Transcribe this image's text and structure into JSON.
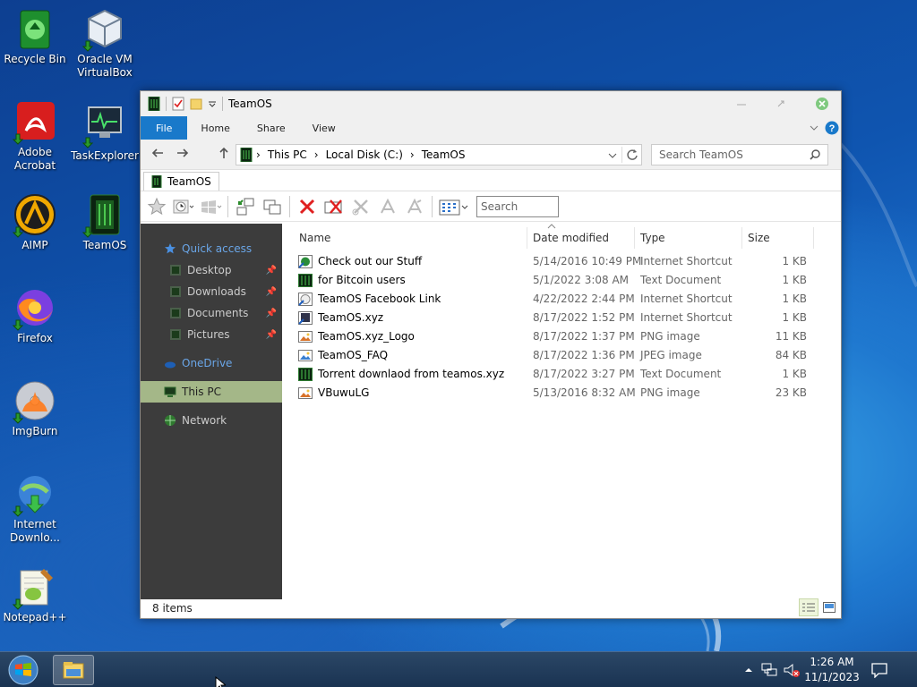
{
  "desktop": {
    "icons": [
      {
        "label": "Recycle Bin",
        "icon": "recycle-bin-icon"
      },
      {
        "label": "Oracle VM VirtualBox",
        "icon": "virtualbox-icon"
      },
      {
        "label": "Adobe Acrobat",
        "icon": "acrobat-icon"
      },
      {
        "label": "TaskExplorer",
        "icon": "task-explorer-icon"
      },
      {
        "label": "AIMP",
        "icon": "aimp-icon"
      },
      {
        "label": "TeamOS",
        "icon": "teamos-icon"
      },
      {
        "label": "Firefox",
        "icon": "firefox-icon"
      },
      {
        "label": "ImgBurn",
        "icon": "imgburn-icon"
      },
      {
        "label": "Internet Downlo...",
        "icon": "internet-download-manager-icon"
      },
      {
        "label": "Notepad++",
        "icon": "notepad-plus-plus-icon"
      }
    ]
  },
  "window": {
    "title": "TeamOS",
    "ribbon_tabs": [
      "File",
      "Home",
      "Share",
      "View"
    ],
    "address": {
      "crumbs": [
        "This PC",
        "Local Disk (C:)",
        "TeamOS"
      ]
    },
    "search_placeholder": "Search TeamOS",
    "folder_tab": "TeamOS",
    "toolbar_search_placeholder": "Search",
    "nav": {
      "quick_access": "Quick access",
      "items": [
        "Desktop",
        "Downloads",
        "Documents",
        "Pictures"
      ],
      "onedrive": "OneDrive",
      "this_pc": "This PC",
      "network": "Network"
    },
    "columns": [
      "Name",
      "Date modified",
      "Type",
      "Size"
    ],
    "files": [
      {
        "name": "Check out our Stuff",
        "date": "5/14/2016 10:49 PM",
        "type": "Internet Shortcut",
        "size": "1 KB",
        "icon": "internet-shortcut-icon"
      },
      {
        "name": "for Bitcoin users",
        "date": "5/1/2022 3:08 AM",
        "type": "Text Document",
        "size": "1 KB",
        "icon": "text-document-icon"
      },
      {
        "name": "TeamOS Facebook Link",
        "date": "4/22/2022 2:44 PM",
        "type": "Internet Shortcut",
        "size": "1 KB",
        "icon": "internet-shortcut-icon"
      },
      {
        "name": "TeamOS.xyz",
        "date": "8/17/2022 1:52 PM",
        "type": "Internet Shortcut",
        "size": "1 KB",
        "icon": "internet-shortcut-icon"
      },
      {
        "name": "TeamOS.xyz_Logo",
        "date": "8/17/2022 1:37 PM",
        "type": "PNG image",
        "size": "11 KB",
        "icon": "png-image-icon"
      },
      {
        "name": "TeamOS_FAQ",
        "date": "8/17/2022 1:36 PM",
        "type": "JPEG image",
        "size": "84 KB",
        "icon": "jpeg-image-icon"
      },
      {
        "name": "Torrent downlaod from teamos.xyz",
        "date": "8/17/2022 3:27 PM",
        "type": "Text Document",
        "size": "1 KB",
        "icon": "text-document-icon"
      },
      {
        "name": "VBuwuLG",
        "date": "5/13/2016 8:32 AM",
        "type": "PNG image",
        "size": "23 KB",
        "icon": "png-image-icon"
      }
    ],
    "status": "8 items"
  },
  "taskbar": {
    "time": "1:26 AM",
    "date": "11/1/2023"
  }
}
